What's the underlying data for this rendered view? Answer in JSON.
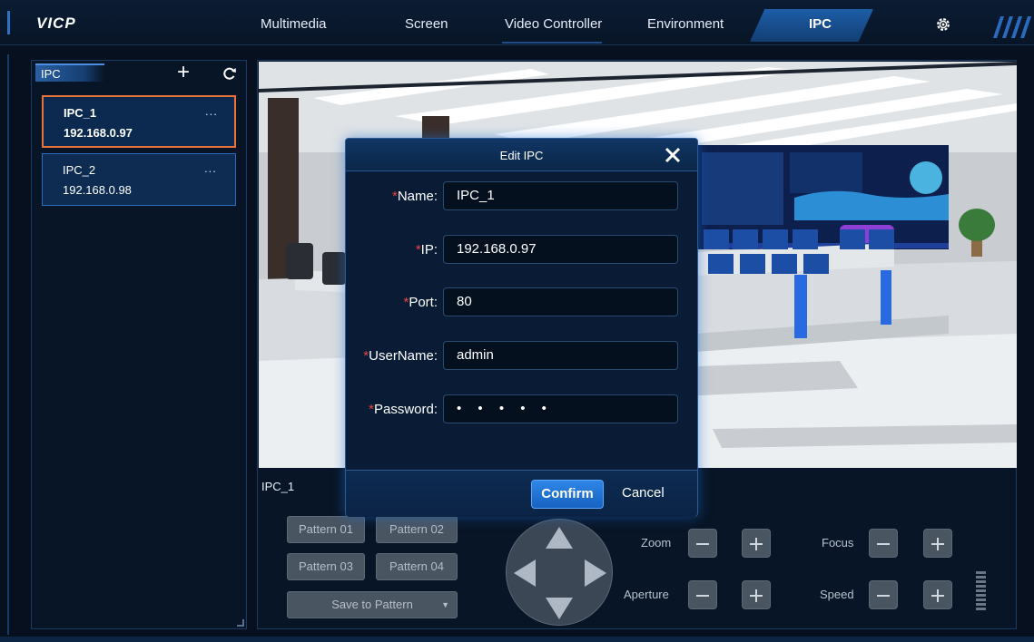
{
  "app": {
    "logo": "VICP"
  },
  "nav": {
    "tabs": [
      {
        "label": "Multimedia"
      },
      {
        "label": "Screen"
      },
      {
        "label": "Video Controller"
      },
      {
        "label": "Environment"
      },
      {
        "label": "IPC"
      }
    ],
    "active_tab": "IPC",
    "settings_icon": "gear-icon"
  },
  "sidebar": {
    "title": "IPC",
    "add_icon": "plus-icon",
    "refresh_icon": "refresh-icon",
    "items": [
      {
        "name": "IPC_1",
        "ip": "192.168.0.97",
        "more": "...",
        "selected": true
      },
      {
        "name": "IPC_2",
        "ip": "192.168.0.98",
        "more": "...",
        "selected": false
      }
    ]
  },
  "controls": {
    "camera_label": "IPC_1",
    "patterns": [
      "Pattern 01",
      "Pattern 02",
      "Pattern 03",
      "Pattern 04"
    ],
    "save_to_pattern": "Save to Pattern",
    "zoom_label": "Zoom",
    "focus_label": "Focus",
    "aperture_label": "Aperture",
    "speed_label": "Speed"
  },
  "dialog": {
    "title": "Edit IPC",
    "required_mark": "*",
    "fields": {
      "name": {
        "label": "Name:",
        "value": "IPC_1"
      },
      "ip": {
        "label": "IP:",
        "value": "192.168.0.97"
      },
      "port": {
        "label": "Port:",
        "value": "80"
      },
      "username": {
        "label": "UserName:",
        "value": "admin"
      },
      "password": {
        "label": "Password:",
        "value": "• • • • •"
      }
    },
    "confirm_label": "Confirm",
    "cancel_label": "Cancel"
  },
  "colors": {
    "accent": "#1f6fd1",
    "selected_border": "#e8743b",
    "required": "#e8453c",
    "background": "#06101e"
  }
}
